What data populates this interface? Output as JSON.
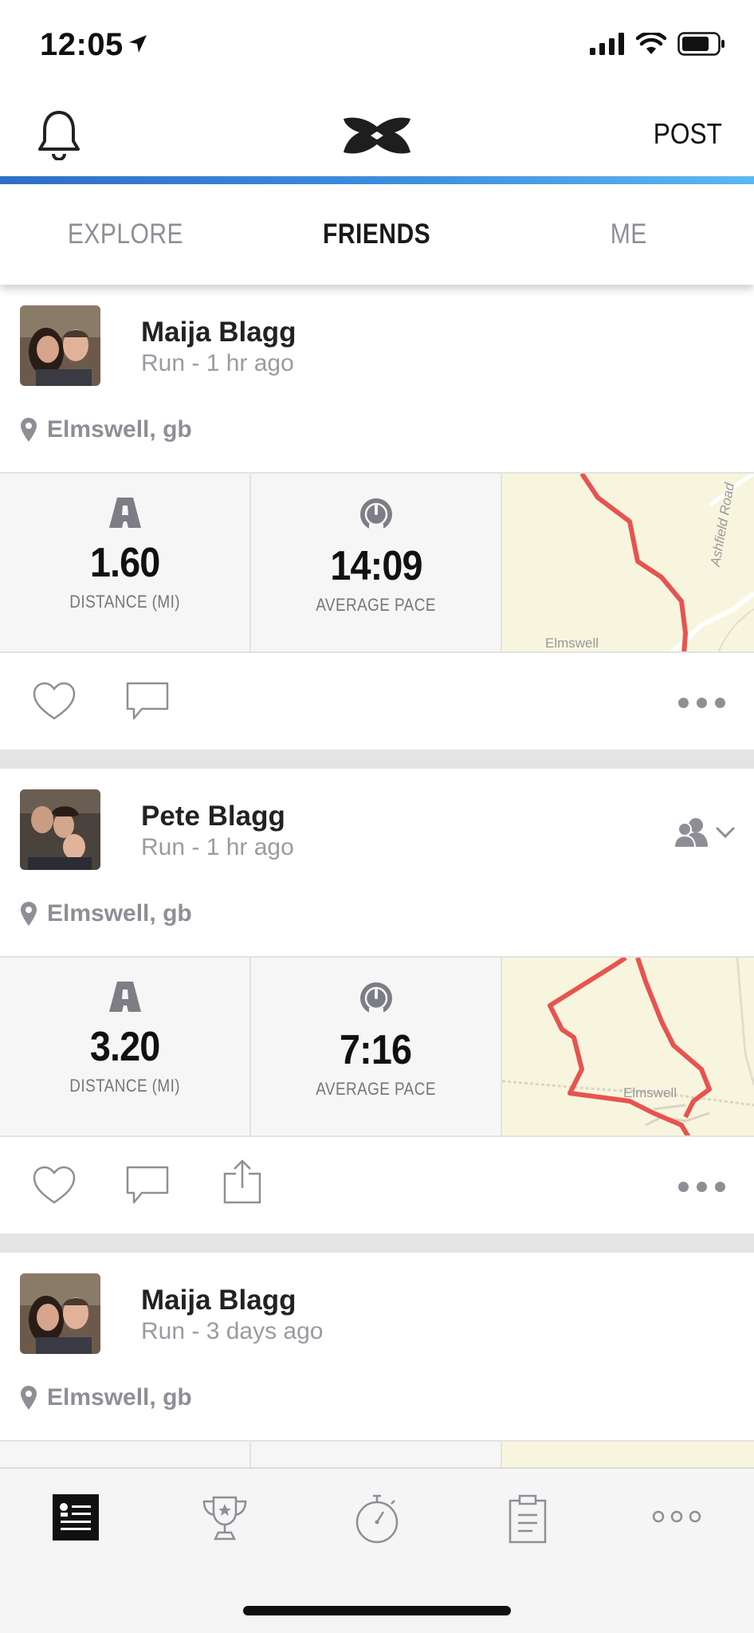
{
  "status_bar": {
    "time": "12:05"
  },
  "header": {
    "post_label": "POST"
  },
  "tabs": [
    {
      "label": "EXPLORE"
    },
    {
      "label": "FRIENDS"
    },
    {
      "label": "ME"
    }
  ],
  "feed": [
    {
      "name": "Maija Blagg",
      "subtitle": "Run - 1 hr ago",
      "location": "Elmswell, gb",
      "distance": "1.60",
      "distance_label": "DISTANCE (MI)",
      "pace": "14:09",
      "pace_label": "AVERAGE PACE",
      "map_labels": [
        "Ashfield Road",
        "Elmswell"
      ]
    },
    {
      "name": "Pete Blagg",
      "subtitle": "Run - 1 hr ago",
      "location": "Elmswell, gb",
      "distance": "3.20",
      "distance_label": "DISTANCE (MI)",
      "pace": "7:16",
      "pace_label": "AVERAGE PACE",
      "map_labels": [
        "Elmswell"
      ]
    },
    {
      "name": "Maija Blagg",
      "subtitle": "Run - 3 days ago",
      "location": "Elmswell, gb"
    }
  ],
  "icons": {
    "bell": "bell-icon",
    "logo": "under-armour-logo",
    "location": "location-pin-icon",
    "distance": "road-icon",
    "pace": "speedometer-icon",
    "like": "heart-icon",
    "comment": "comment-icon",
    "share": "share-icon",
    "more": "more-dots-icon",
    "friends": "friends-icon"
  },
  "colors": {
    "accent_gradient_start": "#2e6fc8",
    "accent_gradient_end": "#5cb8f2",
    "route": "#e8534f",
    "map_bg": "#f8f5df"
  }
}
